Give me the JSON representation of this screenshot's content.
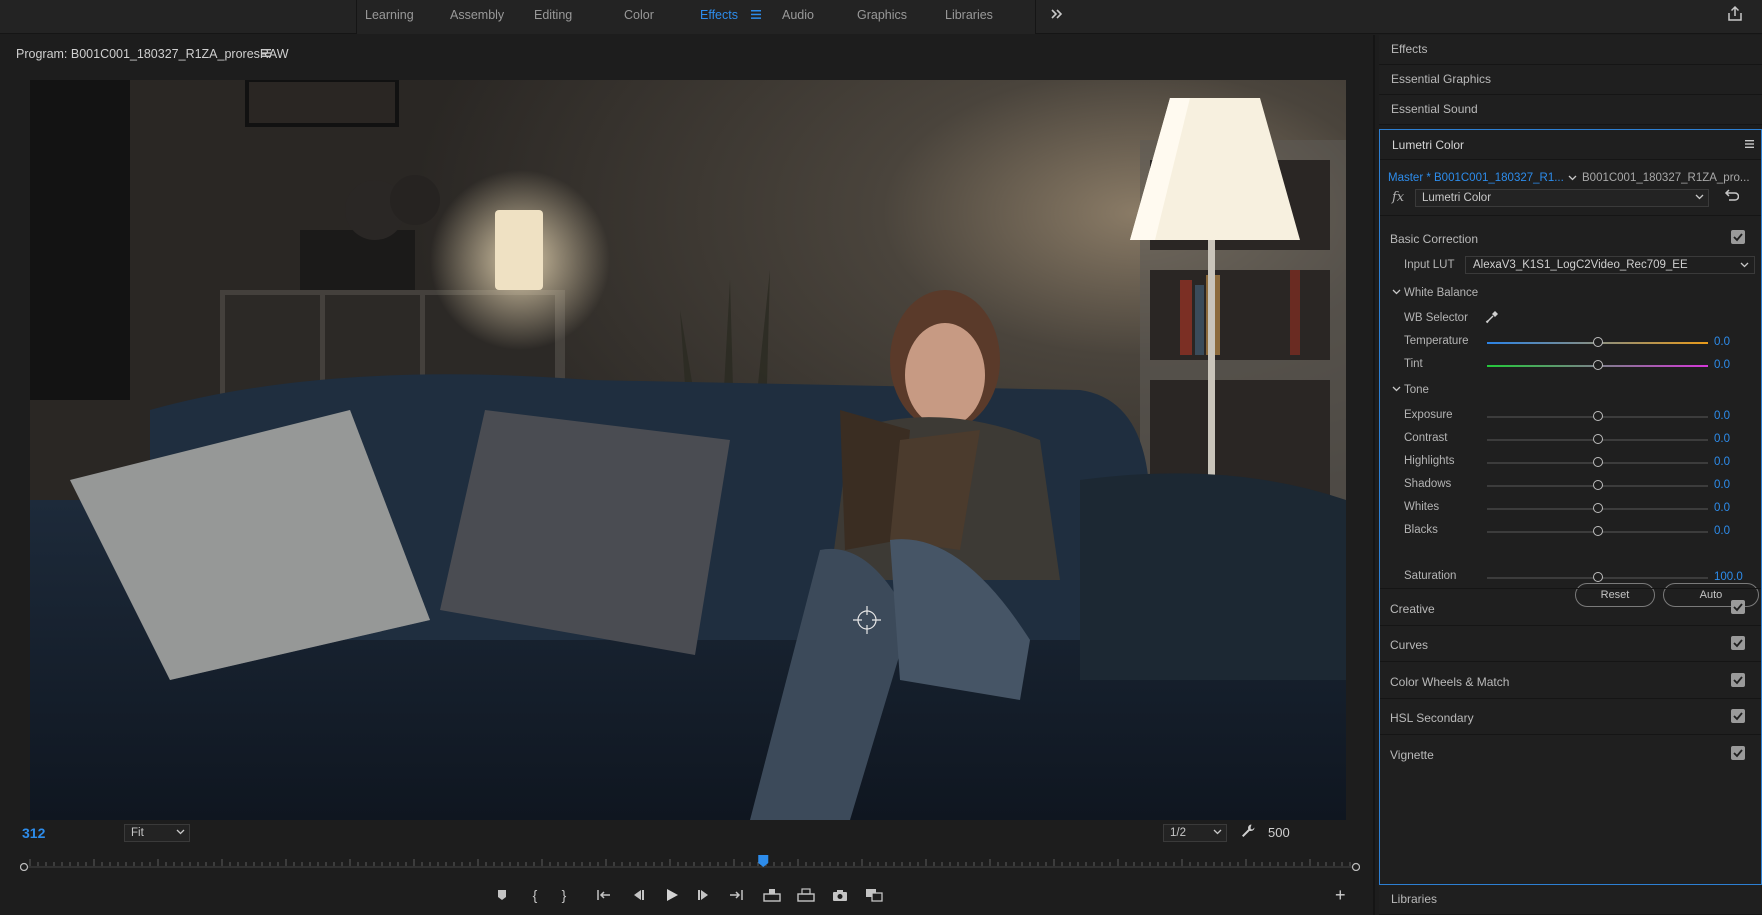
{
  "workspace_tabs": [
    "Learning",
    "Assembly",
    "Editing",
    "Color",
    "Effects",
    "Audio",
    "Graphics",
    "Libraries"
  ],
  "active_workspace": "Effects",
  "program": {
    "title": "Program: B001C001_180327_R1ZA_proresRAW",
    "timecode": "312",
    "fit_label": "Fit",
    "resolution_label": "1/2",
    "right_timecode": "500",
    "playhead_fraction": 0.555
  },
  "side_tabs": {
    "effects": "Effects",
    "essential_graphics": "Essential Graphics",
    "essential_sound": "Essential Sound",
    "libraries": "Libraries"
  },
  "lumetri": {
    "title": "Lumetri Color",
    "master_clip": "Master * B001C001_180327_R1...",
    "clip_name": "B001C001_180327_R1ZA_pro...",
    "fx_symbol": "fx",
    "effect_name": "Lumetri Color",
    "basic_correction": "Basic Correction",
    "input_lut_label": "Input LUT",
    "input_lut_value": "AlexaV3_K1S1_LogC2Video_Rec709_EE",
    "white_balance": "White Balance",
    "wb_selector": "WB Selector",
    "temperature": {
      "label": "Temperature",
      "value": "0.0"
    },
    "tint": {
      "label": "Tint",
      "value": "0.0"
    },
    "tone": "Tone",
    "tone_rows": [
      {
        "label": "Exposure",
        "value": "0.0"
      },
      {
        "label": "Contrast",
        "value": "0.0"
      },
      {
        "label": "Highlights",
        "value": "0.0"
      },
      {
        "label": "Shadows",
        "value": "0.0"
      },
      {
        "label": "Whites",
        "value": "0.0"
      },
      {
        "label": "Blacks",
        "value": "0.0"
      }
    ],
    "reset_label": "Reset",
    "auto_label": "Auto",
    "saturation": {
      "label": "Saturation",
      "value": "100.0"
    },
    "sections": [
      "Creative",
      "Curves",
      "Color Wheels & Match",
      "HSL Secondary",
      "Vignette"
    ]
  },
  "colors": {
    "accent_blue": "#2d8ceb",
    "panel_bg": "#1d1d1d"
  }
}
